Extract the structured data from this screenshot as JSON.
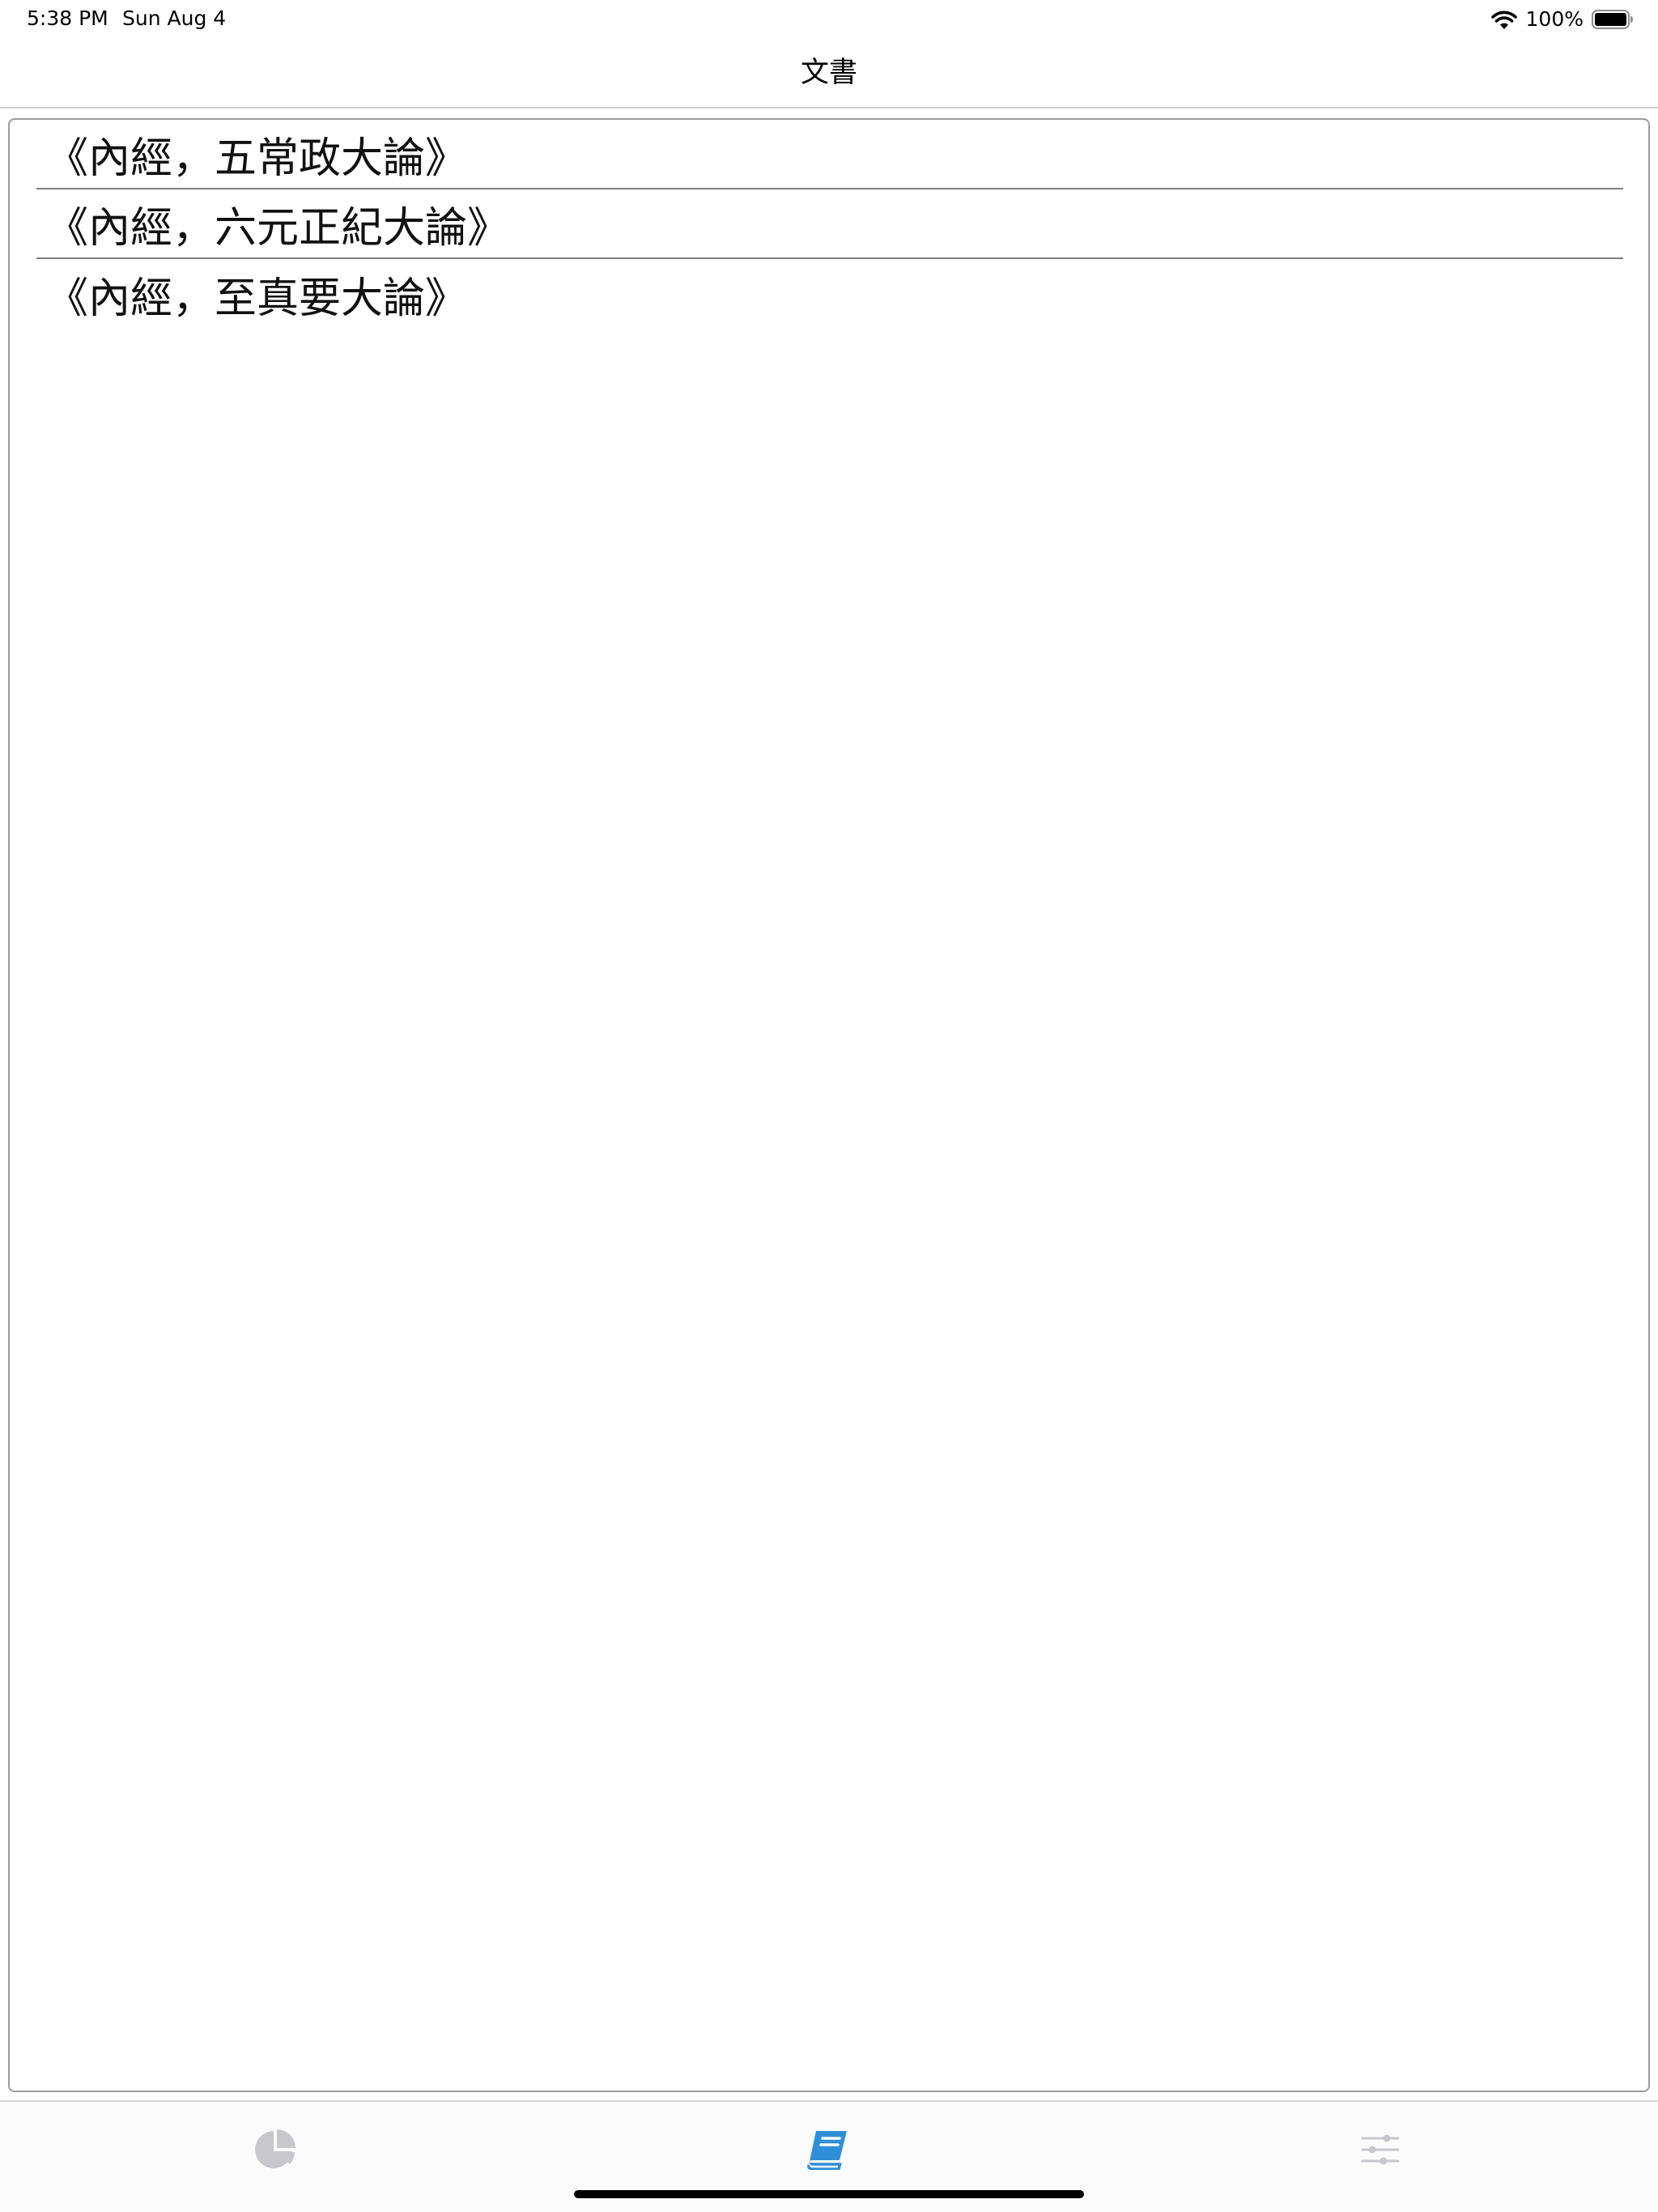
{
  "status_bar": {
    "time": "5:38 PM",
    "date": "Sun Aug 4",
    "battery_percent": "100%",
    "wifi_icon": "wifi-icon",
    "battery_icon": "battery-full-icon",
    "battery_level": 1.0
  },
  "nav": {
    "title": "文書"
  },
  "documents": [
    {
      "title": "《內經，五常政大論》"
    },
    {
      "title": "《內經，六元正紀大論》"
    },
    {
      "title": "《內經，至真要大論》"
    }
  ],
  "tab_bar": {
    "selected": "documents",
    "tabs": [
      {
        "id": "stats",
        "icon": "pie-chart-icon"
      },
      {
        "id": "documents",
        "icon": "book-icon"
      },
      {
        "id": "settings",
        "icon": "sliders-icon"
      }
    ],
    "colors": {
      "active": "#2f8fd8",
      "inactive": "#c7c7cc"
    }
  }
}
